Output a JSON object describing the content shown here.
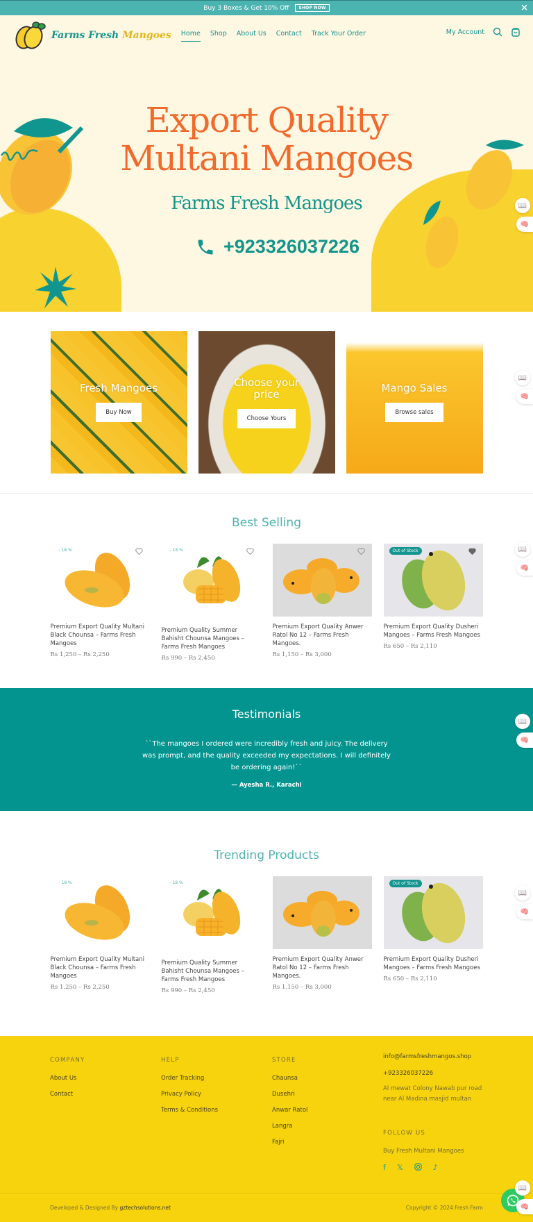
{
  "announcement": {
    "text": "Buy 3 Boxes & Get 10% Off",
    "cta": "SHOP NOW",
    "close": "×"
  },
  "header": {
    "logo_part1": "Farms Fresh ",
    "logo_part2": "Mangoes",
    "nav": [
      "Home",
      "Shop",
      "About Us",
      "Contact",
      "Track Your Order"
    ],
    "account": "My Account"
  },
  "hero": {
    "title_line1": "Export Quality",
    "title_line2": "Multani Mangoes",
    "subtitle": "Farms Fresh Mangoes",
    "phone": "+923326037226"
  },
  "categories": [
    {
      "title": "Fresh Mangoes",
      "button": "Buy Now"
    },
    {
      "title": "Choose your price",
      "button": "Choose Yours"
    },
    {
      "title": "Mango Sales",
      "button": "Browse sales"
    }
  ],
  "best_selling": {
    "title": "Best Selling",
    "products": [
      {
        "badge": "- 18 %",
        "badge_type": "discount",
        "name": "Premium Export Quality Multani Black Chounsa – Farms Fresh Mangoes",
        "price": "Rs 1,250 – Rs 2,250"
      },
      {
        "badge": "- 18 %",
        "badge_type": "discount",
        "name": "Premium Quality Summer Bahisht Chounsa Mangoes – Farms Fresh Mangoes",
        "price": "Rs 990 – Rs 2,450"
      },
      {
        "badge": "",
        "badge_type": "none",
        "name": "Premium Export Quality Anwer Ratol No 12 – Farms Fresh Mangoes.",
        "price": "Rs 1,150 – Rs 3,000"
      },
      {
        "badge": "Out of Stock",
        "badge_type": "stock",
        "name": "Premium Export Quality Dusheri Mangoes – Farms Fresh Mangoes",
        "price": "Rs 650 – Rs 2,110"
      }
    ]
  },
  "testimonials": {
    "title": "Testimonials",
    "quote": "``The mangoes I ordered were incredibly fresh and juicy. The delivery was prompt, and the quality exceeded my expectations. I will definitely be ordering again!``",
    "author": "— Ayesha R., Karachi"
  },
  "trending": {
    "title": "Trending Products",
    "products": [
      {
        "badge": "- 18 %",
        "badge_type": "discount",
        "name": "Premium Export Quality Multani Black Chounsa – Farms Fresh Mangoes",
        "price": "Rs 1,250 – Rs 2,250"
      },
      {
        "badge": "- 18 %",
        "badge_type": "discount",
        "name": "Premium Quality Summer Bahisht Chounsa Mangoes – Farms Fresh Mangoes",
        "price": "Rs 990 – Rs 2,450"
      },
      {
        "badge": "",
        "badge_type": "none",
        "name": "Premium Export Quality Anwer Ratol No 12 – Farms Fresh Mangoes.",
        "price": "Rs 1,150 – Rs 3,000"
      },
      {
        "badge": "Out of Stock",
        "badge_type": "stock",
        "name": "Premium Export Quality Dusheri Mangoes – Farms Fresh Mangoes",
        "price": "Rs 650 – Rs 2,110"
      }
    ]
  },
  "footer": {
    "company": {
      "heading": "COMPANY",
      "links": [
        "About Us",
        "Contact"
      ]
    },
    "help": {
      "heading": "HELP",
      "links": [
        "Order Tracking",
        "Privacy Policy",
        "Terms & Conditions"
      ]
    },
    "store": {
      "heading": "STORE",
      "links": [
        "Chaunsa",
        "Dusehri",
        "Anwar Ratol",
        "Langra",
        "Fajri"
      ]
    },
    "contact": {
      "email": "info@farmsfreshmangos.shop",
      "phone": "+923326037226",
      "address": "Al mewat Colony Nawab pur road near Al Madina masjid multan"
    },
    "follow": {
      "heading": "FOLLOW US",
      "text": "Buy Fresh Multani Mangoes",
      "icons": [
        "facebook-icon",
        "x-twitter-icon",
        "instagram-icon",
        "tiktok-icon"
      ]
    },
    "developed_prefix": "Developed & Designed By ",
    "developed_by": "gztechsolutions.net",
    "copyright": "Copyright © 2024 Fresh Farm"
  },
  "colors": {
    "teal": "#14958f",
    "announcement_bg": "#4bb3b0",
    "hero_orange": "#f06a2c",
    "cream": "#fef7e2",
    "mango_yellow": "#f8d22f",
    "footer_yellow": "#f6d30c",
    "testimonial_bg": "#03948f"
  }
}
